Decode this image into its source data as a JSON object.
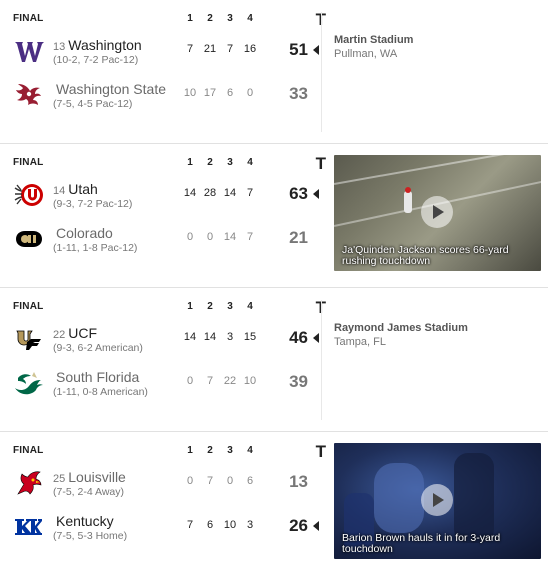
{
  "period_headers": [
    "1",
    "2",
    "3",
    "4",
    "T"
  ],
  "games": [
    {
      "status": "FINAL",
      "teams": [
        {
          "rank": "13",
          "name": "Washington",
          "record": "(10-2, 7-2 Pac-12)",
          "quarters": [
            "7",
            "21",
            "7",
            "16"
          ],
          "total": "51",
          "winner": true,
          "logo": "washington-logo"
        },
        {
          "rank": "",
          "name": "Washington State",
          "record": "(7-5, 4-5 Pac-12)",
          "quarters": [
            "10",
            "17",
            "6",
            "0"
          ],
          "total": "33",
          "winner": false,
          "logo": "washington-state-logo"
        }
      ],
      "venue": {
        "name": "Martin Stadium",
        "location": "Pullman, WA"
      }
    },
    {
      "status": "FINAL",
      "teams": [
        {
          "rank": "14",
          "name": "Utah",
          "record": "(9-3, 7-2 Pac-12)",
          "quarters": [
            "14",
            "28",
            "14",
            "7"
          ],
          "total": "63",
          "winner": true,
          "logo": "utah-logo"
        },
        {
          "rank": "",
          "name": "Colorado",
          "record": "(1-11, 1-8 Pac-12)",
          "quarters": [
            "0",
            "0",
            "14",
            "7"
          ],
          "total": "21",
          "winner": false,
          "logo": "colorado-logo"
        }
      ],
      "video": {
        "caption": "Ja'Quinden Jackson scores 66-yard rushing touchdown"
      }
    },
    {
      "status": "FINAL",
      "teams": [
        {
          "rank": "22",
          "name": "UCF",
          "record": "(9-3, 6-2 American)",
          "quarters": [
            "14",
            "14",
            "3",
            "15"
          ],
          "total": "46",
          "winner": true,
          "logo": "ucf-logo"
        },
        {
          "rank": "",
          "name": "South Florida",
          "record": "(1-11, 0-8 American)",
          "quarters": [
            "0",
            "7",
            "22",
            "10"
          ],
          "total": "39",
          "winner": false,
          "logo": "south-florida-logo"
        }
      ],
      "venue": {
        "name": "Raymond James Stadium",
        "location": "Tampa, FL"
      }
    },
    {
      "status": "FINAL",
      "teams": [
        {
          "rank": "25",
          "name": "Louisville",
          "record": "(7-5, 2-4 Away)",
          "quarters": [
            "0",
            "7",
            "0",
            "6"
          ],
          "total": "13",
          "winner": false,
          "logo": "louisville-logo"
        },
        {
          "rank": "",
          "name": "Kentucky",
          "record": "(7-5, 5-3 Home)",
          "quarters": [
            "7",
            "6",
            "10",
            "3"
          ],
          "total": "26",
          "winner": true,
          "logo": "kentucky-logo"
        }
      ],
      "video": {
        "caption": "Barion Brown hauls it in for 3-yard touchdown"
      }
    }
  ],
  "colors": {
    "washington": "#4b2e83",
    "washington_state": "#981e32",
    "utah": "#cc0000",
    "colorado": "#000000",
    "ucf": "#b5985a",
    "south_florida": "#006747",
    "louisville": "#c9001f",
    "kentucky": "#0033a0"
  }
}
